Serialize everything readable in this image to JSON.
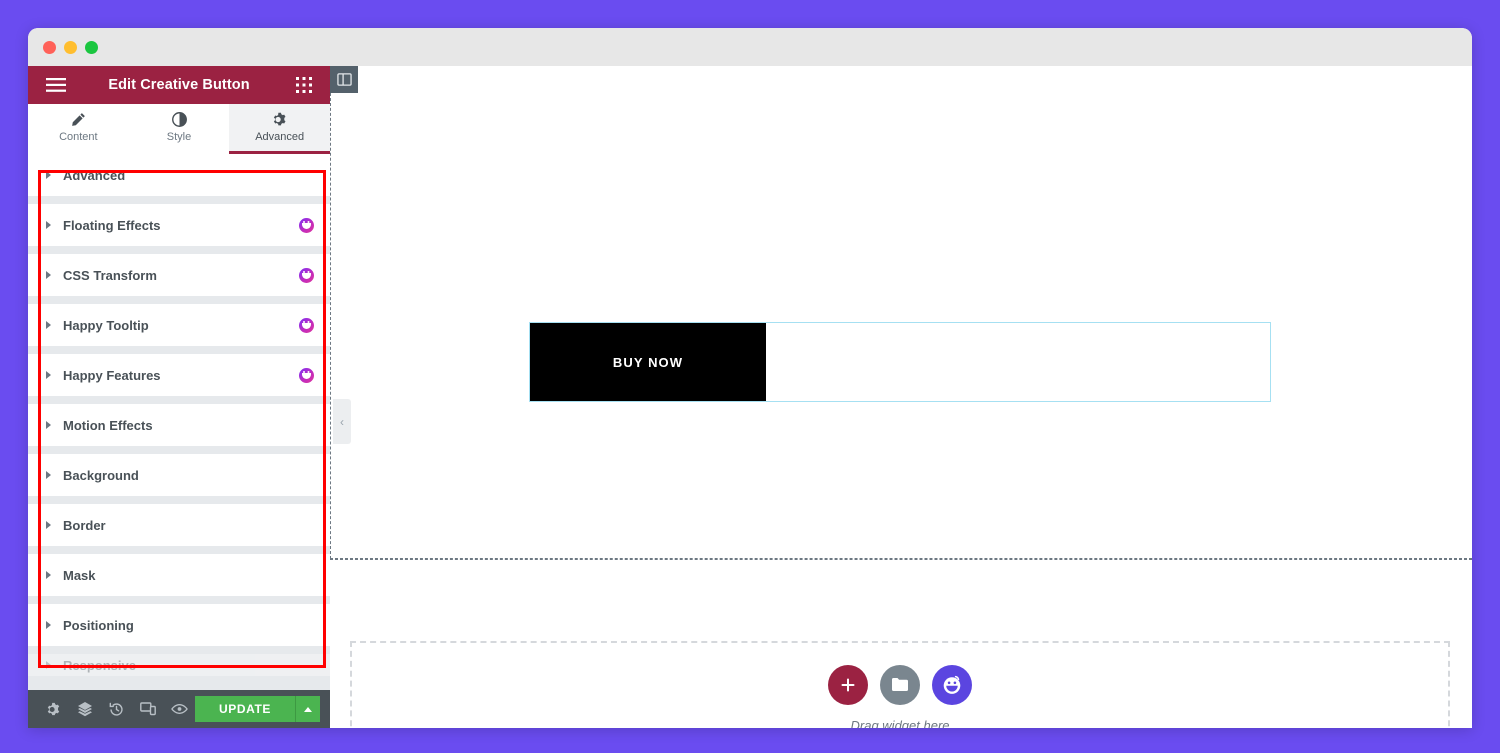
{
  "desktop": {
    "background_color": "#6a4cf0"
  },
  "window": {
    "traffic_lights": [
      "close",
      "minimize",
      "zoom"
    ]
  },
  "panel": {
    "header": {
      "title": "Edit Creative Button",
      "menu_icon": "hamburger-icon",
      "apps_icon": "grid-apps-icon",
      "background_color": "#9b2242"
    },
    "tabs": [
      {
        "label": "Content",
        "icon": "pencil-icon",
        "active": false
      },
      {
        "label": "Style",
        "icon": "contrast-icon",
        "active": false
      },
      {
        "label": "Advanced",
        "icon": "gear-icon",
        "active": true
      }
    ],
    "sections": [
      {
        "label": "Advanced",
        "badge": false
      },
      {
        "label": "Floating Effects",
        "badge": true
      },
      {
        "label": "CSS Transform",
        "badge": true
      },
      {
        "label": "Happy Tooltip",
        "badge": true
      },
      {
        "label": "Happy Features",
        "badge": true
      },
      {
        "label": "Motion Effects",
        "badge": false
      },
      {
        "label": "Background",
        "badge": false
      },
      {
        "label": "Border",
        "badge": false
      },
      {
        "label": "Mask",
        "badge": false
      },
      {
        "label": "Positioning",
        "badge": false
      },
      {
        "label": "Responsive",
        "badge": false
      }
    ],
    "footer": {
      "icons": [
        "gear-icon",
        "layers-icon",
        "history-icon",
        "responsive-icon",
        "eye-preview-icon"
      ],
      "update_label": "UPDATE",
      "update_color": "#4bb450",
      "caret_icon": "caret-up-icon"
    }
  },
  "canvas": {
    "panel_toggle_icon": "panel-layout-icon",
    "collapse_icon": "chevron-left-icon",
    "widget": {
      "button_label": "BUY NOW",
      "button_background": "#000000",
      "selection_border_color": "#a6e0f2"
    },
    "dropzone": {
      "label": "Drag widget here",
      "buttons": [
        {
          "icon": "plus-icon",
          "color": "#9b2242"
        },
        {
          "icon": "folder-icon",
          "color": "#7a868f"
        },
        {
          "icon": "happy-face-icon",
          "color": "#5b45e0"
        }
      ]
    }
  },
  "annotation": {
    "box_color": "#ff0000"
  }
}
